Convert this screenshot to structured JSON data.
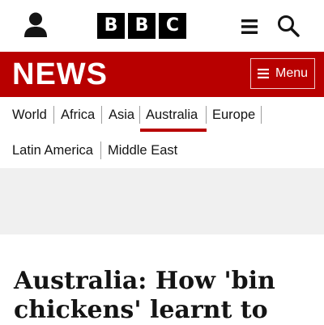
{
  "header": {
    "brand_letters": [
      "B",
      "B",
      "C"
    ],
    "account_icon": "person-icon",
    "more_icon": "hamburger-icon",
    "search_icon": "magnifier-icon"
  },
  "newsbar": {
    "title": "NEWS",
    "menu_label": "Menu",
    "background_color": "#b80000"
  },
  "nav": {
    "items": [
      {
        "label": "World"
      },
      {
        "label": "Africa"
      },
      {
        "label": "Asia"
      },
      {
        "label": "Australia",
        "selected": true
      },
      {
        "label": "Europe"
      },
      {
        "label": "Latin America"
      },
      {
        "label": "Middle East"
      }
    ],
    "selected_color": "#b80000"
  },
  "article": {
    "headline": "Australia: How 'bin chickens' learnt to"
  }
}
